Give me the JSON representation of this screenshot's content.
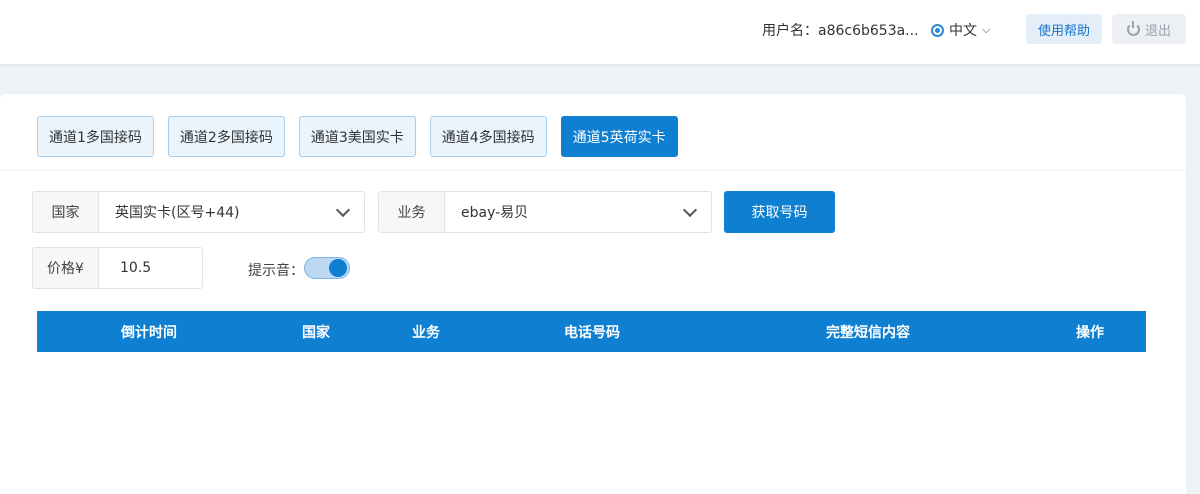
{
  "header": {
    "user_label": "用户名：a86c6b653a...",
    "language": "中文",
    "help_label": "使用帮助",
    "logout_label": "退出"
  },
  "tabs": [
    {
      "label": "通道1多国接码",
      "active": false
    },
    {
      "label": "通道2多国接码",
      "active": false
    },
    {
      "label": "通道3美国实卡",
      "active": false
    },
    {
      "label": "通道4多国接码",
      "active": false
    },
    {
      "label": "通道5英荷实卡",
      "active": true
    }
  ],
  "form": {
    "country_label": "国家",
    "country_value": "英国实卡(区号+44)",
    "service_label": "业务",
    "service_value": "ebay-易贝",
    "get_number_label": "获取号码",
    "price_label": "价格¥",
    "price_value": "10.5",
    "tone_label": "提示音：",
    "tone_on": true
  },
  "table": {
    "columns": [
      "倒计时间",
      "国家",
      "业务",
      "电话号码",
      "完整短信内容",
      "操作"
    ],
    "rows": []
  },
  "colors": {
    "primary": "#0e7fd1",
    "tab_bg": "#eaf4fc",
    "page_bg": "#eef2f6"
  }
}
